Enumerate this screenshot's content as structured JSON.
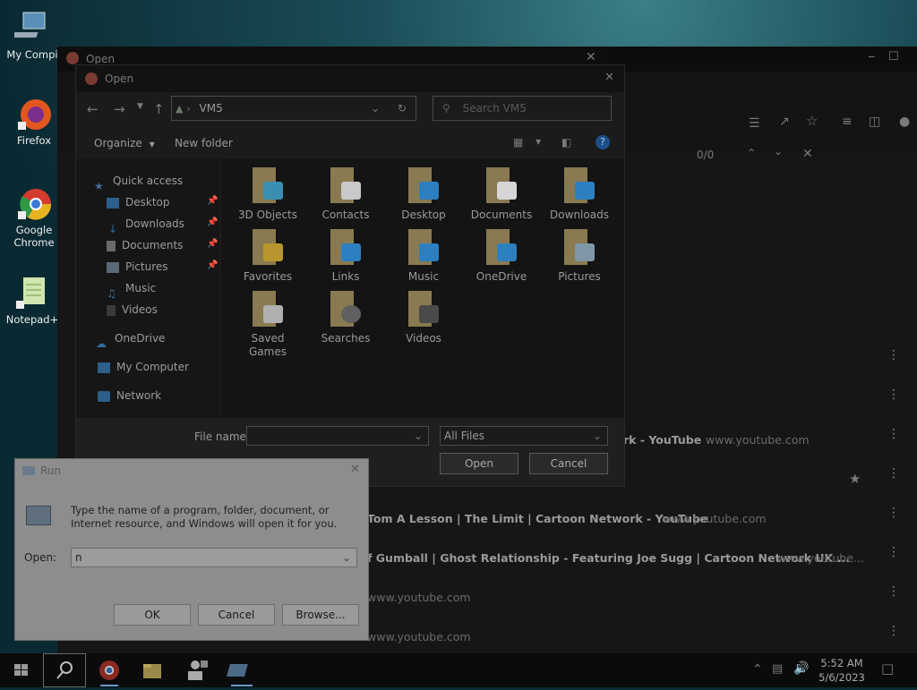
{
  "desktop": {
    "icons": [
      {
        "label": "My Compi",
        "icon": "computer-icon"
      },
      {
        "label": "Firefox",
        "icon": "firefox-icon"
      },
      {
        "label": "Google Chrome",
        "icon": "chrome-icon"
      },
      {
        "label": "Notepad+",
        "icon": "notepad-icon"
      }
    ]
  },
  "chrome_window": {
    "find_bar": {
      "count": "0/0"
    },
    "history": [
      {
        "title": "",
        "url": ""
      },
      {
        "title": "",
        "url": ""
      },
      {
        "title": "rk - YouTube",
        "url": "www.youtube.com"
      },
      {
        "title": "",
        "url": "",
        "starred": true
      },
      {
        "title": "Tom A Lesson | The Limit | Cartoon Network - YouTube",
        "url": "www.youtube.com"
      },
      {
        "title": "f Gumball | Ghost Relationship - Featuring Joe Sugg | Cartoon Network UK ...",
        "url": "www.youtube..."
      },
      {
        "title": "",
        "url": "www.youtube.com"
      },
      {
        "title": "",
        "url": "www.youtube.com"
      }
    ]
  },
  "open_dialog_outer": {
    "title": "Open"
  },
  "open_dialog": {
    "title": "Open",
    "path": "VM5",
    "search_placeholder": "Search VM5",
    "organize_label": "Organize",
    "new_folder_label": "New folder",
    "nav_pane": {
      "quick_access": "Quick access",
      "items": [
        {
          "label": "Desktop",
          "pinned": true
        },
        {
          "label": "Downloads",
          "pinned": true
        },
        {
          "label": "Documents",
          "pinned": true
        },
        {
          "label": "Pictures",
          "pinned": true
        },
        {
          "label": "Music",
          "pinned": false
        },
        {
          "label": "Videos",
          "pinned": false
        }
      ],
      "onedrive": "OneDrive",
      "my_computer": "My Computer",
      "network": "Network"
    },
    "folders": [
      {
        "label": "3D Objects",
        "accent": "#3a8fb0"
      },
      {
        "label": "Contacts",
        "accent": "#c9c9c9"
      },
      {
        "label": "Desktop",
        "accent": "#2d7fc0"
      },
      {
        "label": "Documents",
        "accent": "#d6d6d6"
      },
      {
        "label": "Downloads",
        "accent": "#2d7fc0"
      },
      {
        "label": "Favorites",
        "accent": "#b8962e"
      },
      {
        "label": "Links",
        "accent": "#2d7fc0"
      },
      {
        "label": "Music",
        "accent": "#2d7fc0"
      },
      {
        "label": "OneDrive",
        "accent": "#2d7fc0"
      },
      {
        "label": "Pictures",
        "accent": "#7f97a8"
      },
      {
        "label": "Saved Games",
        "accent": "#b0b0b0"
      },
      {
        "label": "Searches",
        "accent": "#606060"
      },
      {
        "label": "Videos",
        "accent": "#4a4a4a"
      }
    ],
    "file_name_label": "File name:",
    "file_name_value": "",
    "file_type": "All Files",
    "open_button": "Open",
    "cancel_button": "Cancel"
  },
  "run_dialog": {
    "title": "Run",
    "description": "Type the name of a program, folder, document, or Internet resource, and Windows will open it for you.",
    "open_label": "Open:",
    "open_value": "n",
    "ok_button": "OK",
    "cancel_button": "Cancel",
    "browse_button": "Browse..."
  },
  "taskbar": {
    "time": "5:52 AM",
    "date": "5/6/2023"
  }
}
